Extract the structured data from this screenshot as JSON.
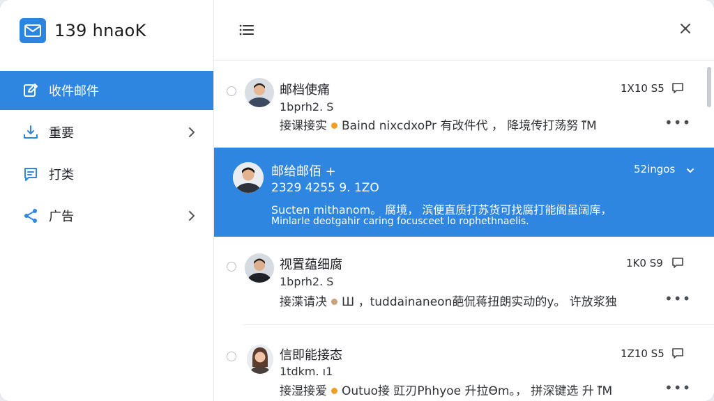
{
  "app": {
    "brand_name": "139 hnaoK",
    "accent_color": "#2e86e1"
  },
  "sidebar": {
    "items": [
      {
        "label": "收件邮件",
        "icon": "edit-icon",
        "active": true,
        "has_chevron": false
      },
      {
        "label": "重要",
        "icon": "inbox-download-icon",
        "active": false,
        "has_chevron": true
      },
      {
        "label": "打类",
        "icon": "message-icon",
        "active": false,
        "has_chevron": false
      },
      {
        "label": "广告",
        "icon": "share-icon",
        "active": false,
        "has_chevron": true
      }
    ]
  },
  "topbar": {
    "menu_icon": "menu-icon",
    "close_icon": "close-icon"
  },
  "messages": [
    {
      "sender": "邮档使痛",
      "time": "1X10 S5",
      "sub": "1bprh2. S",
      "preview_a": "接课接实",
      "dot_color": "#f0a020",
      "preview_b": "Baind nixcdxoPr 有改件代 ， 降境传打荡努 ľ̈M",
      "more": "•••"
    },
    {
      "sender": "邮给邮佰 +",
      "time": "52ingos",
      "sub": "2329 4255 9. 1ZO",
      "line1": "Sucten mithanom。 腐境， 滨便直质打苏货可找腐打能阁虽阔库，",
      "line2": "Minlarle deotgahir caring focusceet lo rophethnaelis.",
      "selected": true
    },
    {
      "sender": "视置蕴细腐",
      "time": "1K0 S9",
      "sub": "1bprh2. S",
      "preview_a": "接渫请决",
      "dot_color": "#c9a27a",
      "preview_b": "Ш ，tuddainaneon葩侃蒋扭朗实动的y。 许放浆独",
      "more": "•••"
    },
    {
      "sender": "信即能接态",
      "time": "1Z10 S5",
      "sub": "1tdkm. ı1",
      "preview_a": "接湿接爱",
      "dot_color": "#f0a020",
      "preview_b": "Outuo接 豇刃Phhyoe 升拉Ɵm。， 拼深键选 升 ľ̈M",
      "more": "•••"
    }
  ]
}
